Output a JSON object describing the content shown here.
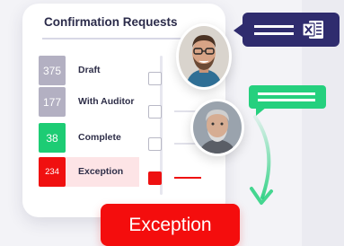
{
  "card": {
    "title": "Confirmation Requests",
    "statuses": [
      {
        "count": "375",
        "label": "Draft",
        "color": "#b3b0c2"
      },
      {
        "count": "177",
        "label": "With Auditor",
        "color": "#b3b0c2"
      },
      {
        "count": "38",
        "label": "Complete",
        "color": "#1dcc74"
      },
      {
        "count": "234",
        "label": "Exception",
        "color": "#f01010",
        "highlighted": true
      }
    ],
    "checkboxes": [
      {
        "checked": false
      },
      {
        "checked": false
      },
      {
        "checked": false
      },
      {
        "checked": true
      }
    ]
  },
  "email_bubble": {
    "icon": "excel-icon",
    "color": "#2f2c6e"
  },
  "chat_bubble": {
    "color": "#25d07e"
  },
  "button": {
    "label": "Exception",
    "color": "#f40d0d"
  },
  "avatars": [
    "avatar-young-man-glasses",
    "avatar-older-man"
  ]
}
